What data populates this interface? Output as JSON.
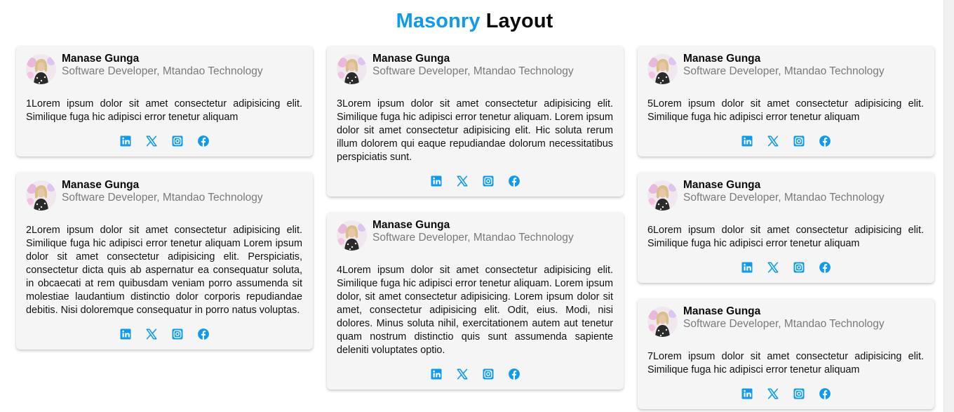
{
  "header": {
    "title_accent": "Masonry",
    "title_rest": "Layout"
  },
  "colors": {
    "accent": "#0d9af0",
    "card_bg": "#f5f5f5",
    "subtitle": "#7a7a7a"
  },
  "cards": [
    {
      "name": "Manase Gunga",
      "role": "Software Developer, Mtandao Technology",
      "text": "1Lorem ipsum dolor sit amet consectetur adipisicing elit. Similique fuga hic adipisci error tenetur aliquam"
    },
    {
      "name": "Manase Gunga",
      "role": "Software Developer, Mtandao Technology",
      "text": "2Lorem ipsum dolor sit amet consectetur adipisicing elit. Similique fuga hic adipisci error tenetur aliquam Lorem ipsum dolor sit amet consectetur adipisicing elit. Perspiciatis, consectetur dicta quis ab aspernatur ea consequatur soluta, in obcaecati at rem quibusdam veniam porro assumenda sit molestiae laudantium distinctio dolor corporis repudiandae debitis. Nisi doloremque consequatur in porro natus voluptas."
    },
    {
      "name": "Manase Gunga",
      "role": "Software Developer, Mtandao Technology",
      "text": "3Lorem ipsum dolor sit amet consectetur adipisicing elit. Similique fuga hic adipisci error tenetur aliquam. Lorem ipsum dolor sit amet consectetur adipisicing elit. Hic soluta rerum illum dolorem qui eaque repudiandae dolorum necessitatibus perspiciatis sunt."
    },
    {
      "name": "Manase Gunga",
      "role": "Software Developer, Mtandao Technology",
      "text": "4Lorem ipsum dolor sit amet consectetur adipisicing elit. Similique fuga hic adipisci error tenetur aliquam. Lorem ipsum dolor, sit amet consectetur adipisicing. Lorem ipsum dolor sit amet, consectetur adipisicing elit. Odit, eius. Modi, nisi dolores. Minus soluta nihil, exercitationem autem aut tenetur quam nostrum distinctio quis sunt assumenda sapiente deleniti voluptates optio."
    },
    {
      "name": "Manase Gunga",
      "role": "Software Developer, Mtandao Technology",
      "text": "5Lorem ipsum dolor sit amet consectetur adipisicing elit. Similique fuga hic adipisci error tenetur aliquam"
    },
    {
      "name": "Manase Gunga",
      "role": "Software Developer, Mtandao Technology",
      "text": "6Lorem ipsum dolor sit amet consectetur adipisicing elit. Similique fuga hic adipisci error tenetur aliquam"
    },
    {
      "name": "Manase Gunga",
      "role": "Software Developer, Mtandao Technology",
      "text": "7Lorem ipsum dolor sit amet consectetur adipisicing elit. Similique fuga hic adipisci error tenetur aliquam"
    }
  ],
  "social_icons": [
    "linkedin-icon",
    "x-icon",
    "instagram-icon",
    "facebook-icon"
  ]
}
